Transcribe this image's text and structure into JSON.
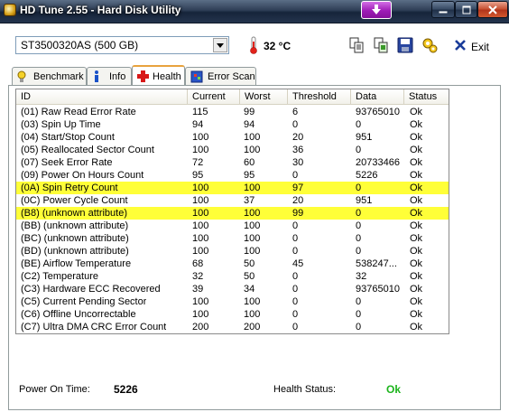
{
  "window": {
    "title": "HD Tune 2.55 - Hard Disk Utility"
  },
  "toolbar": {
    "drive": "ST3500320AS (500 GB)",
    "temperature": "32 °C",
    "exit_label": "Exit"
  },
  "tabs": [
    {
      "label": "Benchmark"
    },
    {
      "label": "Info"
    },
    {
      "label": "Health"
    },
    {
      "label": "Error Scan"
    }
  ],
  "table": {
    "columns": [
      "ID",
      "Current",
      "Worst",
      "Threshold",
      "Data",
      "Status"
    ],
    "rows": [
      {
        "id": "(01) Raw Read Error Rate",
        "current": "115",
        "worst": "99",
        "threshold": "6",
        "data": "93765010",
        "status": "Ok",
        "highlight": false
      },
      {
        "id": "(03) Spin Up Time",
        "current": "94",
        "worst": "94",
        "threshold": "0",
        "data": "0",
        "status": "Ok",
        "highlight": false
      },
      {
        "id": "(04) Start/Stop Count",
        "current": "100",
        "worst": "100",
        "threshold": "20",
        "data": "951",
        "status": "Ok",
        "highlight": false
      },
      {
        "id": "(05) Reallocated Sector Count",
        "current": "100",
        "worst": "100",
        "threshold": "36",
        "data": "0",
        "status": "Ok",
        "highlight": false
      },
      {
        "id": "(07) Seek Error Rate",
        "current": "72",
        "worst": "60",
        "threshold": "30",
        "data": "20733466",
        "status": "Ok",
        "highlight": false
      },
      {
        "id": "(09) Power On Hours Count",
        "current": "95",
        "worst": "95",
        "threshold": "0",
        "data": "5226",
        "status": "Ok",
        "highlight": false
      },
      {
        "id": "(0A) Spin Retry Count",
        "current": "100",
        "worst": "100",
        "threshold": "97",
        "data": "0",
        "status": "Ok",
        "highlight": true
      },
      {
        "id": "(0C) Power Cycle Count",
        "current": "100",
        "worst": "37",
        "threshold": "20",
        "data": "951",
        "status": "Ok",
        "highlight": false
      },
      {
        "id": "(B8) (unknown attribute)",
        "current": "100",
        "worst": "100",
        "threshold": "99",
        "data": "0",
        "status": "Ok",
        "highlight": true
      },
      {
        "id": "(BB) (unknown attribute)",
        "current": "100",
        "worst": "100",
        "threshold": "0",
        "data": "0",
        "status": "Ok",
        "highlight": false
      },
      {
        "id": "(BC) (unknown attribute)",
        "current": "100",
        "worst": "100",
        "threshold": "0",
        "data": "0",
        "status": "Ok",
        "highlight": false
      },
      {
        "id": "(BD) (unknown attribute)",
        "current": "100",
        "worst": "100",
        "threshold": "0",
        "data": "0",
        "status": "Ok",
        "highlight": false
      },
      {
        "id": "(BE) Airflow Temperature",
        "current": "68",
        "worst": "50",
        "threshold": "45",
        "data": "538247...",
        "status": "Ok",
        "highlight": false
      },
      {
        "id": "(C2) Temperature",
        "current": "32",
        "worst": "50",
        "threshold": "0",
        "data": "32",
        "status": "Ok",
        "highlight": false
      },
      {
        "id": "(C3) Hardware ECC Recovered",
        "current": "39",
        "worst": "34",
        "threshold": "0",
        "data": "93765010",
        "status": "Ok",
        "highlight": false
      },
      {
        "id": "(C5) Current Pending Sector",
        "current": "100",
        "worst": "100",
        "threshold": "0",
        "data": "0",
        "status": "Ok",
        "highlight": false
      },
      {
        "id": "(C6) Offline Uncorrectable",
        "current": "100",
        "worst": "100",
        "threshold": "0",
        "data": "0",
        "status": "Ok",
        "highlight": false
      },
      {
        "id": "(C7) Ultra DMA CRC Error Count",
        "current": "200",
        "worst": "200",
        "threshold": "0",
        "data": "0",
        "status": "Ok",
        "highlight": false
      }
    ]
  },
  "status": {
    "power_on_label": "Power On Time:",
    "power_on_value": "5226",
    "health_label": "Health Status:",
    "health_value": "Ok"
  },
  "colors": {
    "highlight_row": "#ffff38",
    "health_ok": "#1cb41c",
    "title_bar": "#24344d"
  }
}
